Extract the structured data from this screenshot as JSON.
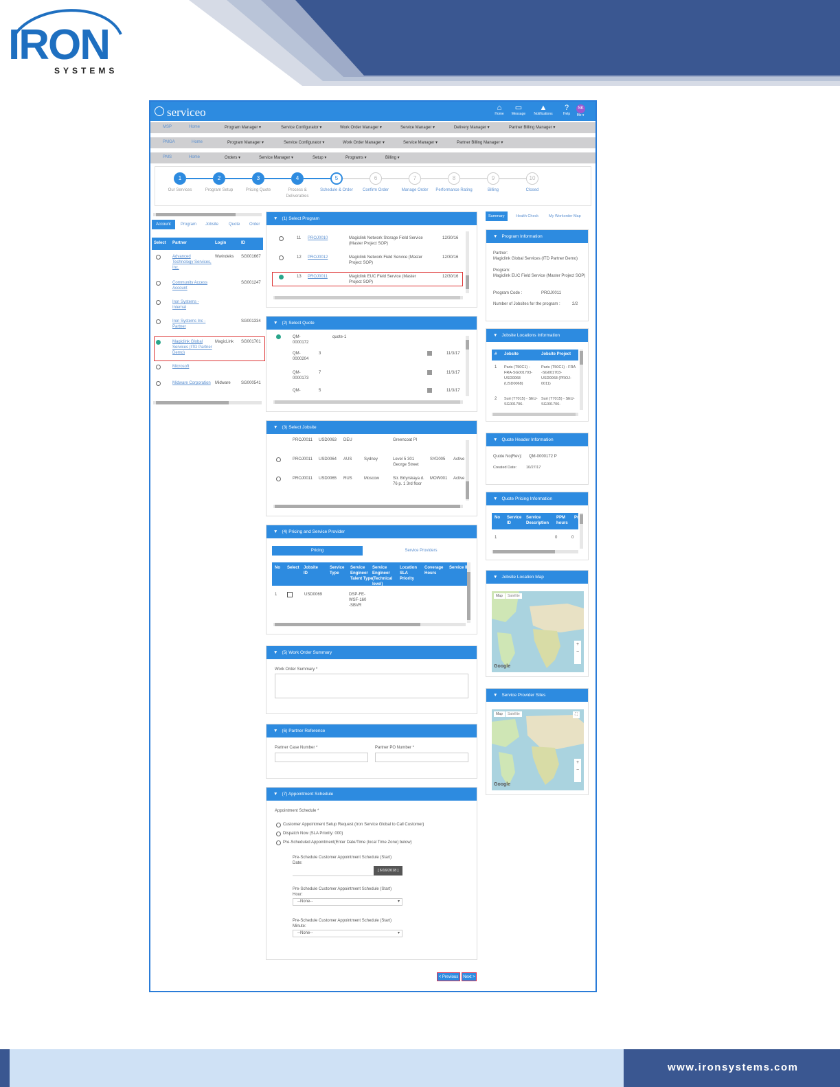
{
  "brand": {
    "logo": "IRON",
    "tagline": "SYSTEMS",
    "website": "www.ironsystems.com"
  },
  "app": {
    "name": "serviceo",
    "toolbar": [
      {
        "label": "Home",
        "icon": "home-icon",
        "glyph": "⌂"
      },
      {
        "label": "Message",
        "icon": "message-icon",
        "glyph": "▭"
      },
      {
        "label": "Notifications",
        "icon": "bell-icon",
        "glyph": "▲"
      },
      {
        "label": "Help",
        "icon": "help-icon",
        "glyph": "?"
      },
      {
        "label": "Me ▾",
        "icon": "user-avatar",
        "glyph": "NK"
      }
    ],
    "menus": [
      {
        "key": "MSP",
        "items": [
          "Home",
          "Program Manager ▾",
          "Service Configurator ▾",
          "Work Order Manager ▾",
          "Service Manager ▾",
          "Delivery Manager ▾",
          "Partner Billing Manager ▾"
        ]
      },
      {
        "key": "PMGA",
        "items": [
          "Home",
          "Program Manager ▾",
          "Service Configurator ▾",
          "Work Order Manager ▾",
          "Service Manager ▾",
          "Partner Billing Manager ▾"
        ]
      },
      {
        "key": "PMS",
        "items": [
          "Home",
          "Orders ▾",
          "Service Manager ▾",
          "Setup ▾",
          "Programs ▾",
          "Billing ▾"
        ]
      }
    ]
  },
  "steps": [
    {
      "num": "1",
      "label": "Our Services",
      "state": "done"
    },
    {
      "num": "2",
      "label": "Program Setup",
      "state": "done"
    },
    {
      "num": "3",
      "label": "Pricing Quote",
      "state": "done"
    },
    {
      "num": "4",
      "label": "Process & Deliverables",
      "state": "done"
    },
    {
      "num": "5",
      "label": "Schedule & Order",
      "state": "current"
    },
    {
      "num": "6",
      "label": "Confirm Order",
      "state": "todo"
    },
    {
      "num": "7",
      "label": "Manage Order",
      "state": "todo"
    },
    {
      "num": "8",
      "label": "Performance Rating",
      "state": "todo"
    },
    {
      "num": "9",
      "label": "Billing",
      "state": "todo"
    },
    {
      "num": "10",
      "label": "Closed",
      "state": "todo"
    }
  ],
  "left": {
    "tabs": [
      "Account",
      "Program",
      "Jobsite",
      "Quote",
      "Order"
    ],
    "columns": [
      "Select",
      "Partner",
      "Login",
      "ID"
    ],
    "rows": [
      {
        "partner": "Advanced Technology Services, Inc.",
        "login": "Wwindeks",
        "id": "SG001667",
        "selected": false
      },
      {
        "partner": "Community Access Account",
        "login": "",
        "id": "SG001247",
        "selected": false
      },
      {
        "partner": "Iron Systems - Internal",
        "login": "",
        "id": "",
        "selected": false
      },
      {
        "partner": "Iron Systems Inc - Partner",
        "login": "",
        "id": "SG001334",
        "selected": false
      },
      {
        "partner": "Magiclink Global Services (ITD Partner Demo)",
        "login": "MagicLink",
        "id": "SG001701",
        "selected": true
      },
      {
        "partner": "Microsoft",
        "login": "",
        "id": "",
        "selected": false
      },
      {
        "partner": "Midware Corporation",
        "login": "Midware",
        "id": "SG000541",
        "selected": false
      }
    ]
  },
  "panels": {
    "p1": {
      "num": "(1)",
      "title": "Select Program",
      "rows": [
        {
          "n": "11",
          "code": "PROJ0010",
          "desc": "Magiclink Network Storage Field Service (Master Project SOP)",
          "date": "12/30/16",
          "selected": false
        },
        {
          "n": "12",
          "code": "PROJ0012",
          "desc": "Magiclink Network Field Service (Master Project SOP)",
          "date": "12/30/16",
          "selected": false
        },
        {
          "n": "13",
          "code": "PROJ0011",
          "desc": "Magiclink EUC Field Service (Master Project SOP)",
          "date": "12/30/16",
          "selected": true
        }
      ]
    },
    "p2": {
      "num": "(2)",
      "title": "Select Quote",
      "rows": [
        {
          "q": "QM-0000172",
          "n": "",
          "desc": "quote-1",
          "date": ""
        },
        {
          "q": "QM-0000204",
          "n": "3",
          "desc": "",
          "date": "11/3/17"
        },
        {
          "q": "QM-0000173",
          "n": "7",
          "desc": "",
          "date": "11/3/17"
        },
        {
          "q": "QM-",
          "n": "5",
          "desc": "",
          "date": "11/3/17"
        }
      ]
    },
    "p3": {
      "num": "(3)",
      "title": "Select Jobsite",
      "rows": [
        {
          "proj": "PROJ0011",
          "id": "USD0063",
          "ctry": "DEU",
          "city": "",
          "addr": "Greencoat Pl",
          "site": "",
          "status": ""
        },
        {
          "proj": "PROJ0011",
          "id": "USD0064",
          "ctry": "AUS",
          "city": "Sydney",
          "addr": "Level 5 301 George Street",
          "site": "SYD005",
          "status": "Active"
        },
        {
          "proj": "PROJ0011",
          "id": "USD0065",
          "ctry": "RUS",
          "city": "Moscow",
          "addr": "Str. Brtyrskaya d. 76 p. 1 3rd floor",
          "site": "MOW001",
          "status": "Active"
        }
      ]
    },
    "p4": {
      "num": "(4)",
      "title": "Pricing and Service Provider",
      "tabs": [
        "Pricing",
        "Service Providers"
      ],
      "columns": [
        "No",
        "Select",
        "Jobsite ID",
        "Service Type",
        "Service Engineer Talent Type",
        "Service Engineer (Technical level)",
        "Location SLA Priority",
        "Coverage Hours",
        "Service ID"
      ],
      "row": {
        "no": "1",
        "jobsite": "USD0069",
        "type": "DSP-FE-WSF-160-SBVR"
      }
    },
    "p5": {
      "num": "(5)",
      "title": "Work Order Summary",
      "label": "Work Order Summary *"
    },
    "p6": {
      "num": "(6)",
      "title": "Partner Reference",
      "label1": "Partner Case Number *",
      "label2": "Partner PO Number *"
    },
    "p7": {
      "num": "(7)",
      "title": "Appointment Schedule",
      "label": "Appointment Schedule *",
      "options": [
        "Customer Appointment Setup Request (Iron Service Global to Call Customer)",
        "Dispatch Now (SLA Priority: 000)",
        "Pre-Scheduled Appointment(Enter Date/Time (local Time Zone) below)"
      ],
      "dateLabel": "Pre-Schedule Customer Appointment Schedule (Start) Date:",
      "dateValue": "[ 6/16/2018 ]",
      "hourLabel": "Pre-Schedule Customer Appointment Schedule (Start) Hour:",
      "minLabel": "Pre-Schedule Customer Appointment Schedule (Start) Minute:",
      "none": "--None--"
    }
  },
  "right": {
    "tabs": [
      "Summary",
      "Health Check",
      "My Workorder Map"
    ],
    "program": {
      "title": "Program Information",
      "partnerLabel": "Partner:",
      "partner": "Magiclink Global Services (ITD Partner Demo)",
      "programLabel": "Program:",
      "program": "Magiclink EUC Field Service (Master Project SOP)",
      "codeLabel": "Program Code :",
      "code": "PROJ0011",
      "countLabel": "Number of Jobsites for the program :",
      "count": "2/2"
    },
    "jobsites": {
      "title": "Jobsite Locations Information",
      "columns": [
        "#",
        "Jobsite",
        "Jobsite Project"
      ],
      "rows": [
        {
          "n": "1",
          "jobsite": "Paris (T50C1) - FRA-SG001703-USD0068 (USD0068)",
          "project": "Paris (T50C1) - FRA -SG001703-USD0068 (PROJ-0011)"
        },
        {
          "n": "2",
          "jobsite": "Suri (T7015) - SEU-SG001706-",
          "project": "Suri (T7015) - SEU-SG001706-"
        }
      ]
    },
    "quoteHeader": {
      "title": "Quote Header Information",
      "qLabel": "Quote No(Rev):",
      "q": "QM-0000172 P",
      "dLabel": "Created Date:",
      "d": "10/27/17"
    },
    "quotePricing": {
      "title": "Quote Pricing Information",
      "columns": [
        "No",
        "Service ID",
        "Service Description",
        "PPM hours",
        "Pr"
      ],
      "row": {
        "no": "1",
        "hours": "0",
        "pr": "0"
      }
    },
    "map1": {
      "title": "Jobsite Location Map",
      "mapTab": "Map",
      "satTab": "Satellite",
      "logo": "Google"
    },
    "map2": {
      "title": "Service Provider Sites",
      "mapTab": "Map",
      "satTab": "Satellite",
      "logo": "Google"
    }
  },
  "nav": {
    "prev": "< Previous",
    "next": "Next >"
  }
}
